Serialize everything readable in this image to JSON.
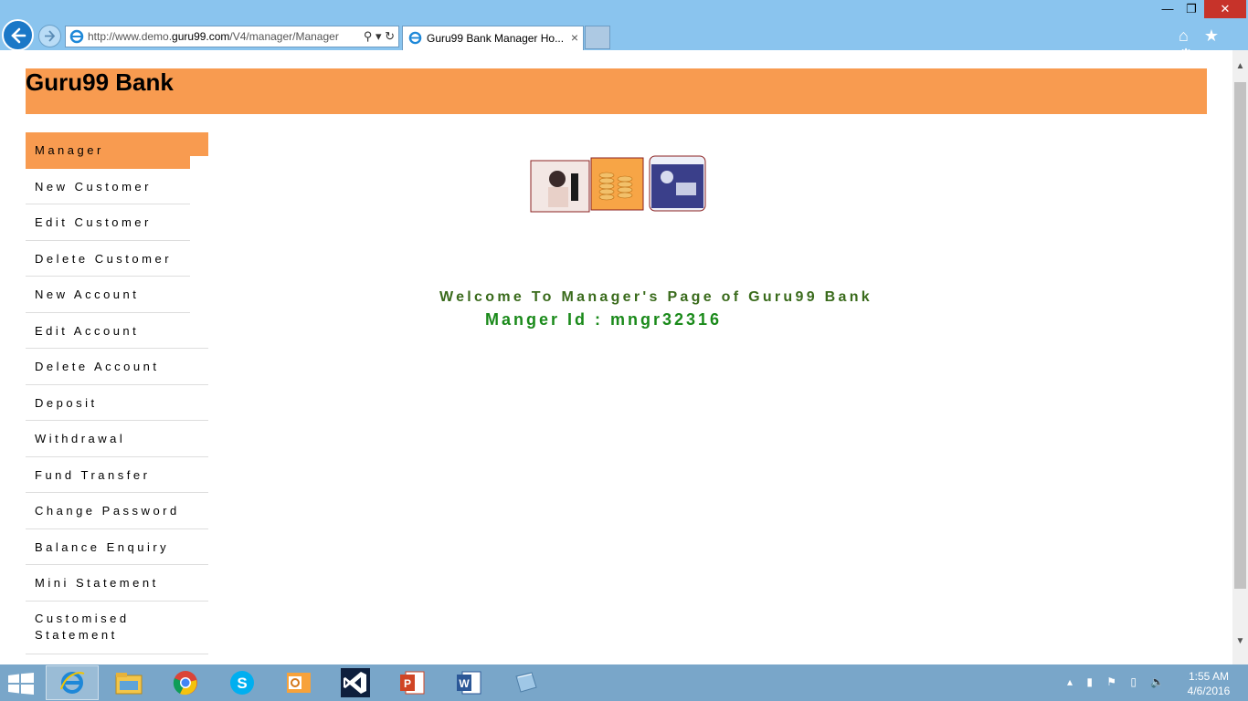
{
  "browser": {
    "url_prefix": "http://www.demo.",
    "url_domain": "guru99.com",
    "url_suffix": "/V4/manager/Manager",
    "tab_title": "Guru99 Bank Manager Ho...",
    "tab_close": "×",
    "addr_icons": "⚲ ▾ ↻",
    "win_min": "—",
    "win_max": "❐",
    "win_close": "✕",
    "tool_icons": "⌂ ★ ⚙"
  },
  "page": {
    "title": "Guru99 Bank",
    "welcome": "Welcome To Manager's Page of Guru99 Bank",
    "manager_id": "Manger Id : mngr32316"
  },
  "menu": {
    "items": [
      {
        "label": "Manager"
      },
      {
        "label": "New Customer"
      },
      {
        "label": "Edit Customer"
      },
      {
        "label": "Delete Customer"
      },
      {
        "label": "New Account"
      },
      {
        "label": "Edit Account"
      },
      {
        "label": "Delete Account"
      },
      {
        "label": "Deposit"
      },
      {
        "label": "Withdrawal"
      },
      {
        "label": "Fund Transfer"
      },
      {
        "label": "Change Password"
      },
      {
        "label": "Balance Enquiry"
      },
      {
        "label": "Mini Statement"
      },
      {
        "label": "Customised"
      },
      {
        "label": "Statement"
      }
    ]
  },
  "scrollbar": {
    "up": "▲",
    "down": "▼"
  },
  "taskbar": {
    "apps": [
      {
        "icon": "internet-explorer-icon"
      },
      {
        "icon": "file-explorer-icon"
      },
      {
        "icon": "chrome-icon"
      },
      {
        "icon": "skype-icon"
      },
      {
        "icon": "outlook-icon"
      },
      {
        "icon": "visual-studio-icon"
      },
      {
        "icon": "powerpoint-icon"
      },
      {
        "icon": "word-icon"
      },
      {
        "icon": "notebook-icon"
      }
    ],
    "tray_icons": "▴ ▮ ⚑ ▯ 🔈",
    "time": "1:55 AM",
    "date": "4/6/2016"
  },
  "colors": {
    "header": "#f89b50",
    "welcome_text": "#3a6b1c",
    "manager_id_text": "#1a8a1a",
    "chrome": "#8ac4ee",
    "taskbar": "#79a6c9"
  }
}
